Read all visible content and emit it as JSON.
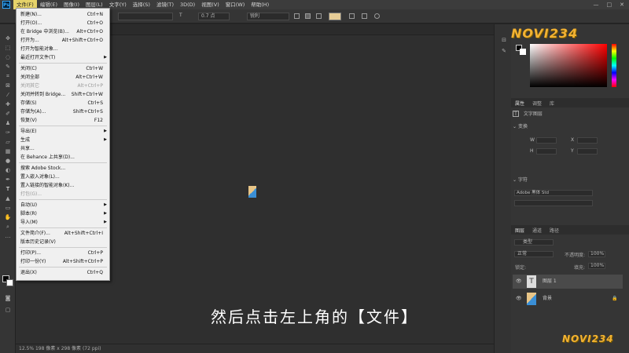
{
  "menubar": {
    "app_icon": "Ps",
    "items": [
      "文件(F)",
      "编辑(E)",
      "图像(I)",
      "图层(L)",
      "文字(Y)",
      "选择(S)",
      "滤镜(T)",
      "3D(D)",
      "视图(V)",
      "窗口(W)",
      "帮助(H)"
    ],
    "window_controls": [
      "—",
      "□",
      "✕"
    ]
  },
  "options": {
    "font_size": "0.7 点",
    "antialias": "锐利",
    "swatch_color": "#e6cc96"
  },
  "file_menu": {
    "items": [
      {
        "label": "新建(N)...",
        "shortcut": "Ctrl+N"
      },
      {
        "label": "打开(O)...",
        "shortcut": "Ctrl+O"
      },
      {
        "label": "在 Bridge 中浏览(B)...",
        "shortcut": "Alt+Ctrl+O"
      },
      {
        "label": "打开为...",
        "shortcut": "Alt+Shift+Ctrl+O"
      },
      {
        "label": "打开为智能对象...",
        "shortcut": ""
      },
      {
        "label": "最近打开文件(T)",
        "shortcut": "",
        "arrow": "▶"
      },
      {
        "label": "关闭(C)",
        "shortcut": "Ctrl+W"
      },
      {
        "label": "关闭全部",
        "shortcut": "Alt+Ctrl+W"
      },
      {
        "label": "关闭其它",
        "shortcut": "Alt+Ctrl+P",
        "disabled": true
      },
      {
        "label": "关闭并转到 Bridge...",
        "shortcut": "Shift+Ctrl+W"
      },
      {
        "label": "存储(S)",
        "shortcut": "Ctrl+S"
      },
      {
        "label": "存储为(A)...",
        "shortcut": "Shift+Ctrl+S"
      },
      {
        "label": "恢复(V)",
        "shortcut": "F12"
      },
      {
        "label": "导出(E)",
        "shortcut": "",
        "arrow": "▶"
      },
      {
        "label": "生成",
        "shortcut": "",
        "arrow": "▶"
      },
      {
        "label": "共享...",
        "shortcut": ""
      },
      {
        "label": "在 Behance 上共享(D)...",
        "shortcut": ""
      },
      {
        "label": "搜索 Adobe Stock...",
        "shortcut": ""
      },
      {
        "label": "置入嵌入对象(L)...",
        "shortcut": ""
      },
      {
        "label": "置入链接的智能对象(K)...",
        "shortcut": ""
      },
      {
        "label": "打包(G)...",
        "shortcut": "",
        "disabled": true
      },
      {
        "label": "自动(U)",
        "shortcut": "",
        "arrow": "▶"
      },
      {
        "label": "脚本(R)",
        "shortcut": "",
        "arrow": "▶"
      },
      {
        "label": "导入(M)",
        "shortcut": "",
        "arrow": "▶"
      },
      {
        "label": "文件简介(F)...",
        "shortcut": "Alt+Shift+Ctrl+I"
      },
      {
        "label": "版本历史记录(V)",
        "shortcut": ""
      },
      {
        "label": "打印(P)...",
        "shortcut": "Ctrl+P"
      },
      {
        "label": "打印一份(Y)",
        "shortcut": "Alt+Shift+Ctrl+P"
      },
      {
        "label": "退出(X)",
        "shortcut": "Ctrl+Q"
      }
    ]
  },
  "subtitle": "然后点击左上角的【文件】",
  "status": "12.5%    198 像素 x 298 像素 (72 ppi)",
  "logo": "NOVI234",
  "properties": {
    "tabs": [
      "属性",
      "调整",
      "库"
    ],
    "layer_type": "文字图层",
    "transform_label": "变换",
    "w": "W",
    "h": "H",
    "x": "X",
    "y": "Y",
    "char_label": "字符",
    "font_name": "Adobe 黑体 Std"
  },
  "layers": {
    "tabs": [
      "图层",
      "通道",
      "路径"
    ],
    "filter": "类型",
    "blend_mode": "正常",
    "opacity_label": "不透明度:",
    "opacity": "100%",
    "lock_label": "锁定:",
    "fill_label": "填充:",
    "fill": "100%",
    "items": [
      {
        "name": "图层 1",
        "kind": "text"
      },
      {
        "name": "背景",
        "kind": "image"
      }
    ]
  }
}
